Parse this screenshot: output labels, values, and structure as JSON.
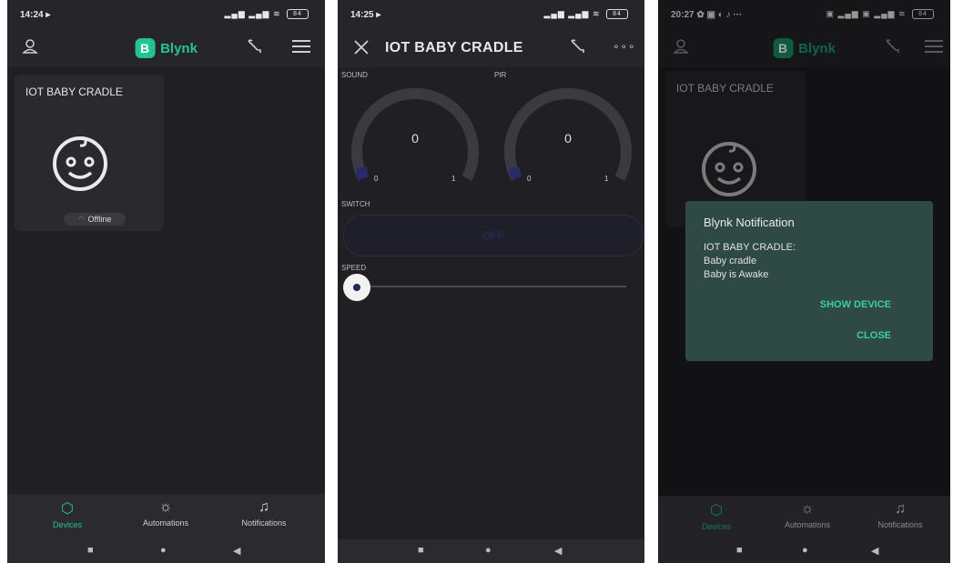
{
  "screen1": {
    "status_time": "14:24 ▸",
    "battery": "84",
    "logo_letter": "B",
    "app_name": "Blynk",
    "device_name": "IOT BABY CRADLE",
    "device_status": "Offline",
    "nav": [
      "Devices",
      "Automations",
      "Notifications"
    ]
  },
  "screen2": {
    "status_time": "14:25 ▸",
    "battery": "84",
    "title": "IOT BABY CRADLE",
    "sound_label": "SOUND",
    "pir_label": "PIR",
    "sound_value": "0",
    "pir_value": "0",
    "gauge_min": "0",
    "gauge_max": "1",
    "switch_label": "SWITCH",
    "switch_state": "OFF",
    "speed_label": "SPEED",
    "speed_fraction": 0
  },
  "screen3": {
    "status_time": "20:27",
    "battery": "84",
    "logo_letter": "B",
    "app_name": "Blynk",
    "device_name": "IOT BABY CRADLE",
    "dialog_title": "Blynk Notification",
    "dialog_line1": "IOT BABY CRADLE:",
    "dialog_line2": "Baby cradle",
    "dialog_line3": "Baby is Awake",
    "show_device": "SHOW DEVICE",
    "close": "CLOSE",
    "nav": [
      "Devices",
      "Automations",
      "Notifications"
    ]
  },
  "colors": {
    "accent": "#23c48e",
    "background": "#202024",
    "dialog": "#2f4a44",
    "offline": "#e05a6a"
  },
  "icons": [
    "user-icon",
    "wrench-icon",
    "menu-icon",
    "close-icon",
    "more-icon",
    "cube-icon",
    "sun-icon",
    "bell-icon",
    "baby-face-icon",
    "wifi-off-icon"
  ]
}
